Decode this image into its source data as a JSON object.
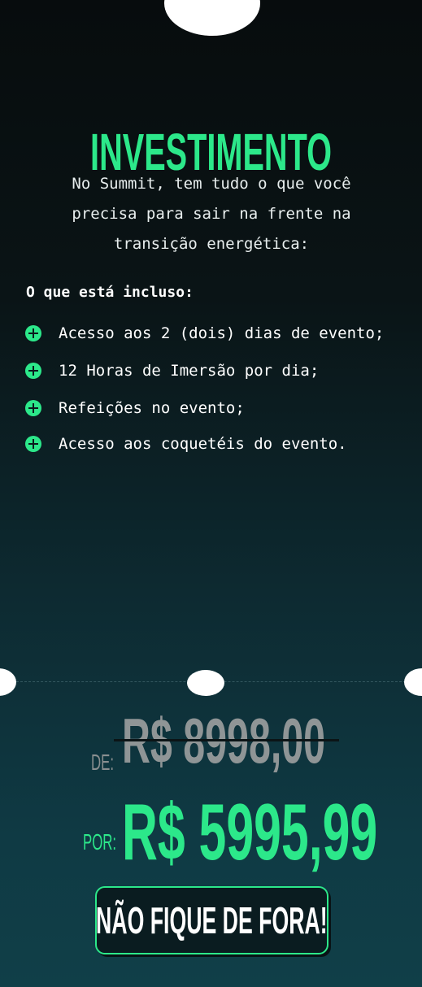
{
  "section": {
    "title": "INVESTIMENTO",
    "intro": "No Summit, tem tudo o que você precisa para sair na frente na transição energética:"
  },
  "included": {
    "label": "O que está incluso:",
    "items": [
      {
        "icon": "plus-circle-icon",
        "text": "Acesso aos 2 (dois) dias de evento;"
      },
      {
        "icon": "plus-circle-icon",
        "text": "12 Horas de Imersão por dia;"
      },
      {
        "icon": "plus-circle-icon",
        "text": "Refeições no evento;"
      },
      {
        "icon": "plus-circle-icon",
        "text": "Acesso aos coquetéis do evento."
      }
    ]
  },
  "pricing": {
    "old_prefix": "DE:",
    "old_price": "R$ 8998,00",
    "new_prefix": "POR:",
    "new_price": "R$ 5995,99"
  },
  "cta": {
    "label": "NÃO FIQUE DE FORA!"
  },
  "colors": {
    "accent": "#2ce88a",
    "background_top": "#070c0d",
    "background_bottom": "#103f48",
    "muted_price": "#8f9596"
  }
}
